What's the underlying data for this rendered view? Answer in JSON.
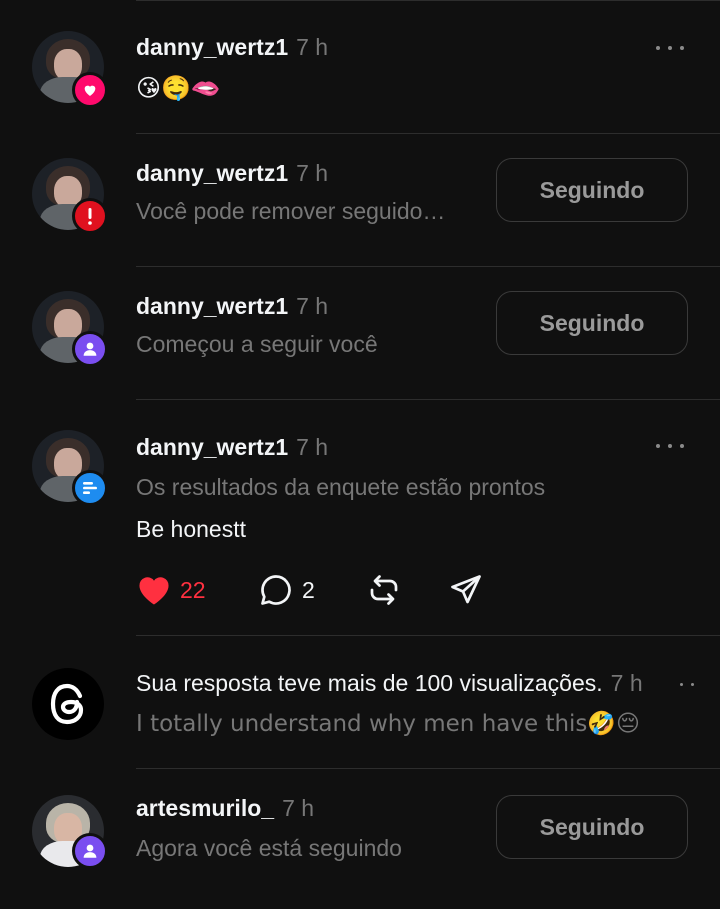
{
  "notifications": [
    {
      "username": "danny_wertz1",
      "time": "7 h",
      "text": "😘🤤🫦",
      "badge_icon": "heart-icon",
      "badge_color": "#ff0a6c"
    },
    {
      "username": "danny_wertz1",
      "time": "7 h",
      "subtitle": "Você pode remover seguido…",
      "button_label": "Seguindo",
      "badge_icon": "exclamation-icon",
      "badge_color": "#e0111f"
    },
    {
      "username": "danny_wertz1",
      "time": "7 h",
      "subtitle": "Começou a seguir você",
      "button_label": "Seguindo",
      "badge_icon": "person-icon",
      "badge_color": "#7a4ef0"
    },
    {
      "username": "danny_wertz1",
      "time": "7 h",
      "subtitle": "Os resultados da enquete estão prontos",
      "body": "Be honestt",
      "badge_icon": "poll-icon",
      "badge_color": "#1e8cf0",
      "likes": "22",
      "comments": "2",
      "like_color": "#ff3040"
    },
    {
      "title": "Sua resposta teve mais de 100 visualizações.",
      "time": "7 h",
      "subtitle": "I totally understand why men have this🤣😔",
      "avatar_icon": "threads-logo-icon"
    },
    {
      "username": "artesmurilo_",
      "time": "7 h",
      "subtitle": "Agora você está seguindo",
      "button_label": "Seguindo",
      "badge_icon": "person-icon",
      "badge_color": "#7a4ef0"
    }
  ]
}
